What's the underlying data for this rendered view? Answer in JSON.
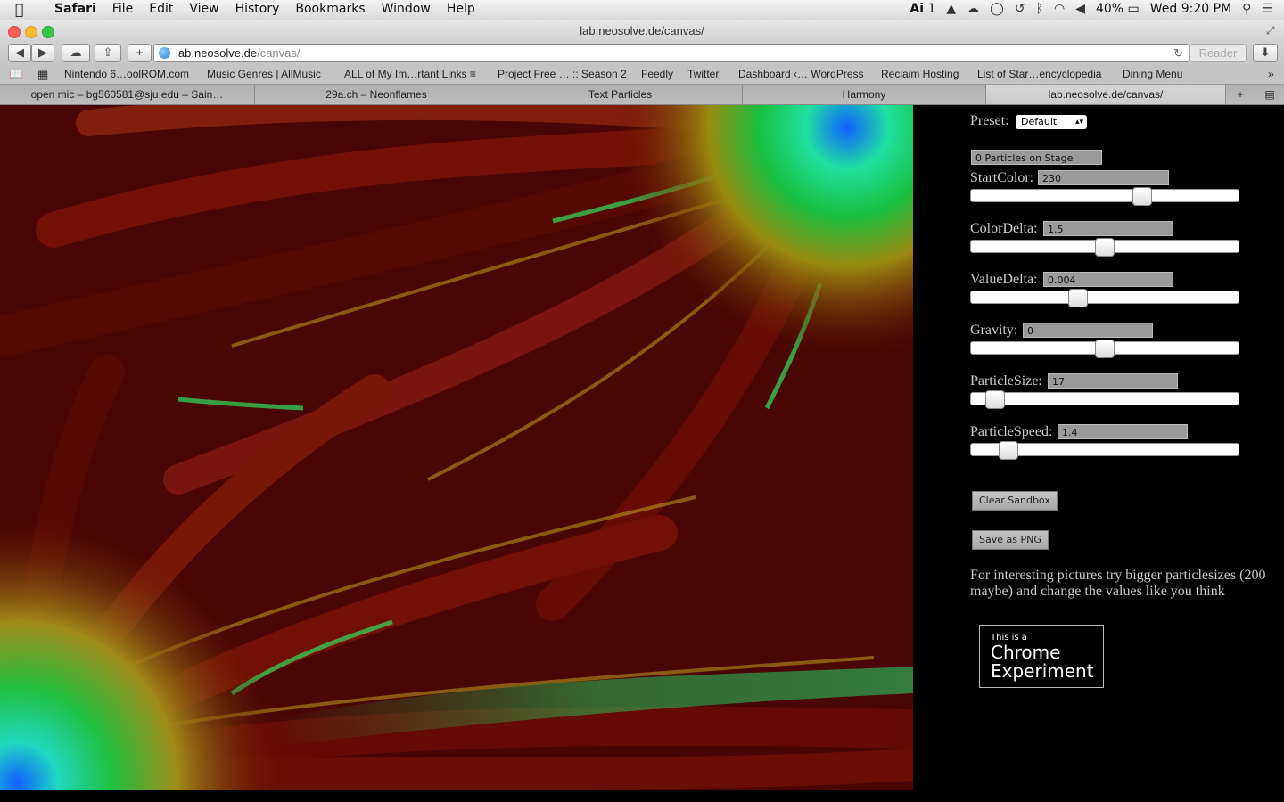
{
  "menubar": {
    "apple": "",
    "app": "Safari",
    "items": [
      "File",
      "Edit",
      "View",
      "History",
      "Bookmarks",
      "Window",
      "Help"
    ],
    "status": {
      "adobe_count": "1",
      "battery": "40%",
      "clock": "Wed 9:20 PM"
    }
  },
  "window": {
    "title": "lab.neosolve.de/canvas/"
  },
  "urlbar": {
    "host": "lab.neosolve.de",
    "path": "/canvas/",
    "reader": "Reader"
  },
  "bookmarks": [
    "Nintendo 6…oolROM.com",
    "Music Genres | AllMusic",
    "ALL of My Im…rtant Links ≡",
    "Project Free … :: Season 2",
    "Feedly",
    "Twitter",
    "Dashboard ‹… WordPress",
    "Reclaim Hosting",
    "List of Star…encyclopedia",
    "Dining Menu"
  ],
  "tabs": [
    "open mic – bg560581@sju.edu – Sain…",
    "29a.ch – Neonflames",
    "Text Particles",
    "Harmony",
    "lab.neosolve.de/canvas/"
  ],
  "controls": {
    "preset_label": "Preset:",
    "preset_value": "Default",
    "particles_count": "0 Particles on Stage",
    "sliders": [
      {
        "label": "StartColor:",
        "value": "230",
        "fraction": 0.64
      },
      {
        "label": "ColorDelta:",
        "value": "1.5",
        "fraction": 0.5
      },
      {
        "label": "ValueDelta:",
        "value": "0.004",
        "fraction": 0.4
      },
      {
        "label": "Gravity:",
        "value": "0",
        "fraction": 0.5
      },
      {
        "label": "ParticleSize:",
        "value": "17",
        "fraction": 0.09
      },
      {
        "label": "ParticleSpeed:",
        "value": "1.4",
        "fraction": 0.14
      }
    ],
    "clear_button": "Clear Sandbox",
    "save_button": "Save as PNG",
    "hint": "For interesting pictures try bigger particlesizes (200 maybe) and change the values like you think",
    "badge_small": "This is a",
    "badge_line1": "Chrome",
    "badge_line2": "Experiment"
  }
}
